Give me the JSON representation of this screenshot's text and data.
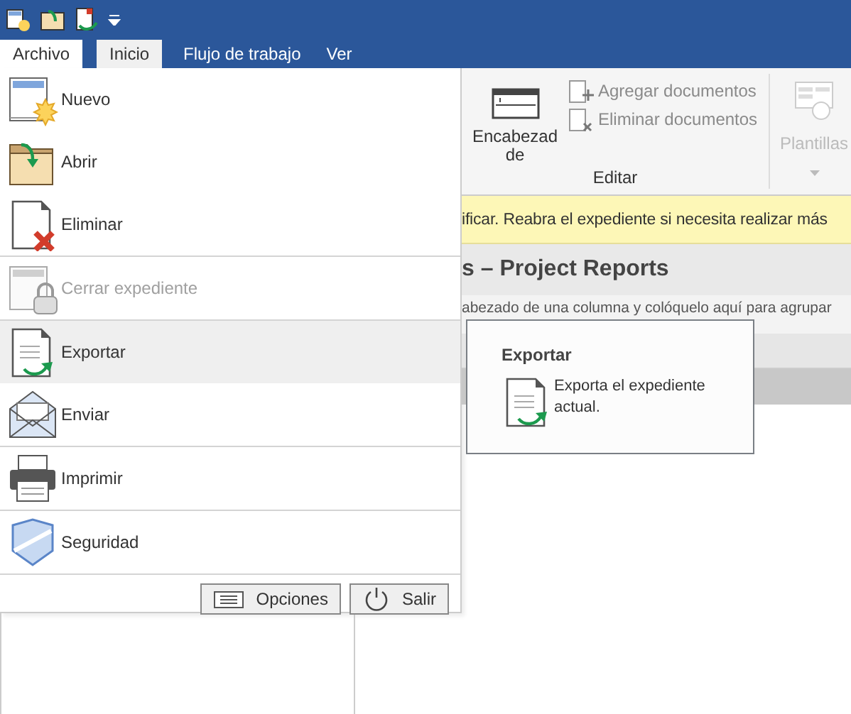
{
  "tabs": [
    {
      "label": "Archivo",
      "selected": true,
      "current": false
    },
    {
      "label": "Inicio",
      "selected": false,
      "current": true
    },
    {
      "label": "Flujo de trabajo",
      "selected": false,
      "current": false
    },
    {
      "label": "Ver",
      "selected": false,
      "current": false
    }
  ],
  "ribbon": {
    "header_button": {
      "label_lines": [
        "Encabezad",
        "de"
      ]
    },
    "commands": [
      {
        "label": "Agregar documentos",
        "disabled": true
      },
      {
        "label": "Eliminar documentos",
        "disabled": true
      }
    ],
    "templates": {
      "label": "Plantillas",
      "disabled": true
    },
    "group_label": "Editar"
  },
  "notice": "ificar. Reabra el expediente si necesita realizar más",
  "view_title": "s – Project Reports",
  "group_hint": "abezado de una columna y colóquelo aquí para agrupar",
  "menu": {
    "groups": [
      [
        {
          "label": "Nuevo",
          "disabled": false,
          "selected": false
        },
        {
          "label": "Abrir",
          "disabled": false,
          "selected": false
        },
        {
          "label": "Eliminar",
          "disabled": false,
          "selected": false
        }
      ],
      [
        {
          "label": "Cerrar expediente",
          "disabled": true,
          "selected": false
        }
      ],
      [
        {
          "label": "Exportar",
          "disabled": false,
          "selected": true
        },
        {
          "label": "Enviar",
          "disabled": false,
          "selected": false
        }
      ],
      [
        {
          "label": "Imprimir",
          "disabled": false,
          "selected": false
        }
      ],
      [
        {
          "label": "Seguridad",
          "disabled": false,
          "selected": false
        }
      ]
    ],
    "buttons": [
      "Opciones",
      "Salir"
    ]
  },
  "tooltip": {
    "title": "Exportar",
    "description": "Exporta el expediente actual."
  }
}
